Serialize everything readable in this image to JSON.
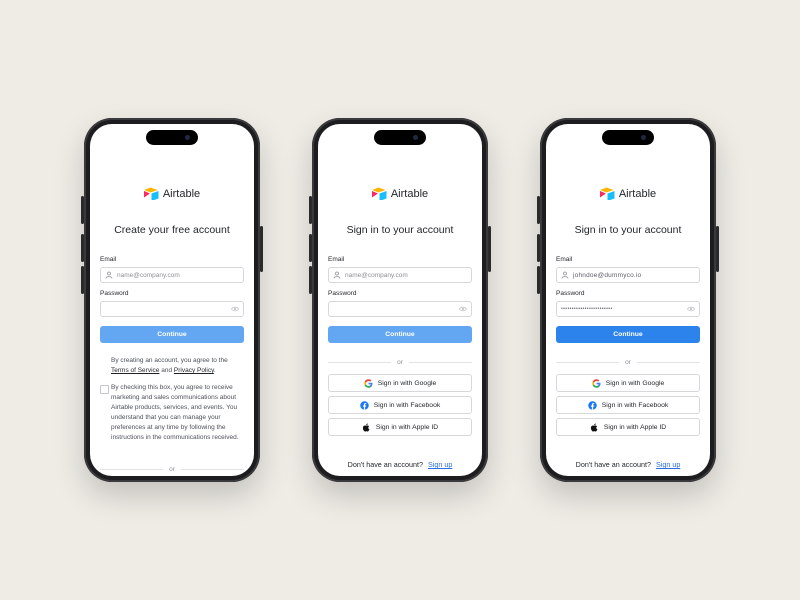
{
  "logo": {
    "text": "Airtable"
  },
  "phones": [
    {
      "title": "Create your free account",
      "email_label": "Email",
      "email_placeholder": "name@company.com",
      "password_label": "Password",
      "continue_label": "Continue",
      "terms_pre": "By creating an account, you agree to the",
      "terms_link": "Terms of Service",
      "terms_and": "and",
      "privacy_link": "Privacy Policy",
      "terms_end": ".",
      "checkbox_text": "By checking this box, you agree to receive marketing and sales communications about Airtable products, services, and events. You understand that you can manage your preferences at any time by following the instructions in the communications received.",
      "or_label": "or"
    },
    {
      "title": "Sign in to your account",
      "email_label": "Email",
      "email_placeholder": "name@company.com",
      "password_label": "Password",
      "continue_label": "Continue",
      "or_label": "or",
      "google_label": "Sign in with Google",
      "facebook_label": "Sign in with Facebook",
      "apple_label": "Sign in with Apple ID",
      "no_account": "Don't have an account?",
      "signup_link": "Sign up"
    },
    {
      "title": "Sign in to your account",
      "email_label": "Email",
      "email_value": "johndoe@dummyco.io",
      "password_label": "Password",
      "password_value": "••••••••••••••••••••••••",
      "continue_label": "Continue",
      "or_label": "or",
      "google_label": "Sign in with Google",
      "facebook_label": "Sign in with Facebook",
      "apple_label": "Sign in with Apple ID",
      "no_account": "Don't have an account?",
      "signup_link": "Sign up"
    }
  ],
  "colors": {
    "background": "#efece6",
    "primary_light": "#63a7f3",
    "primary": "#2d83ec",
    "link": "#2d6fe0"
  },
  "icons": [
    "airtable-logo-icon",
    "user-icon",
    "eye-icon",
    "google-icon",
    "facebook-icon",
    "apple-icon"
  ]
}
